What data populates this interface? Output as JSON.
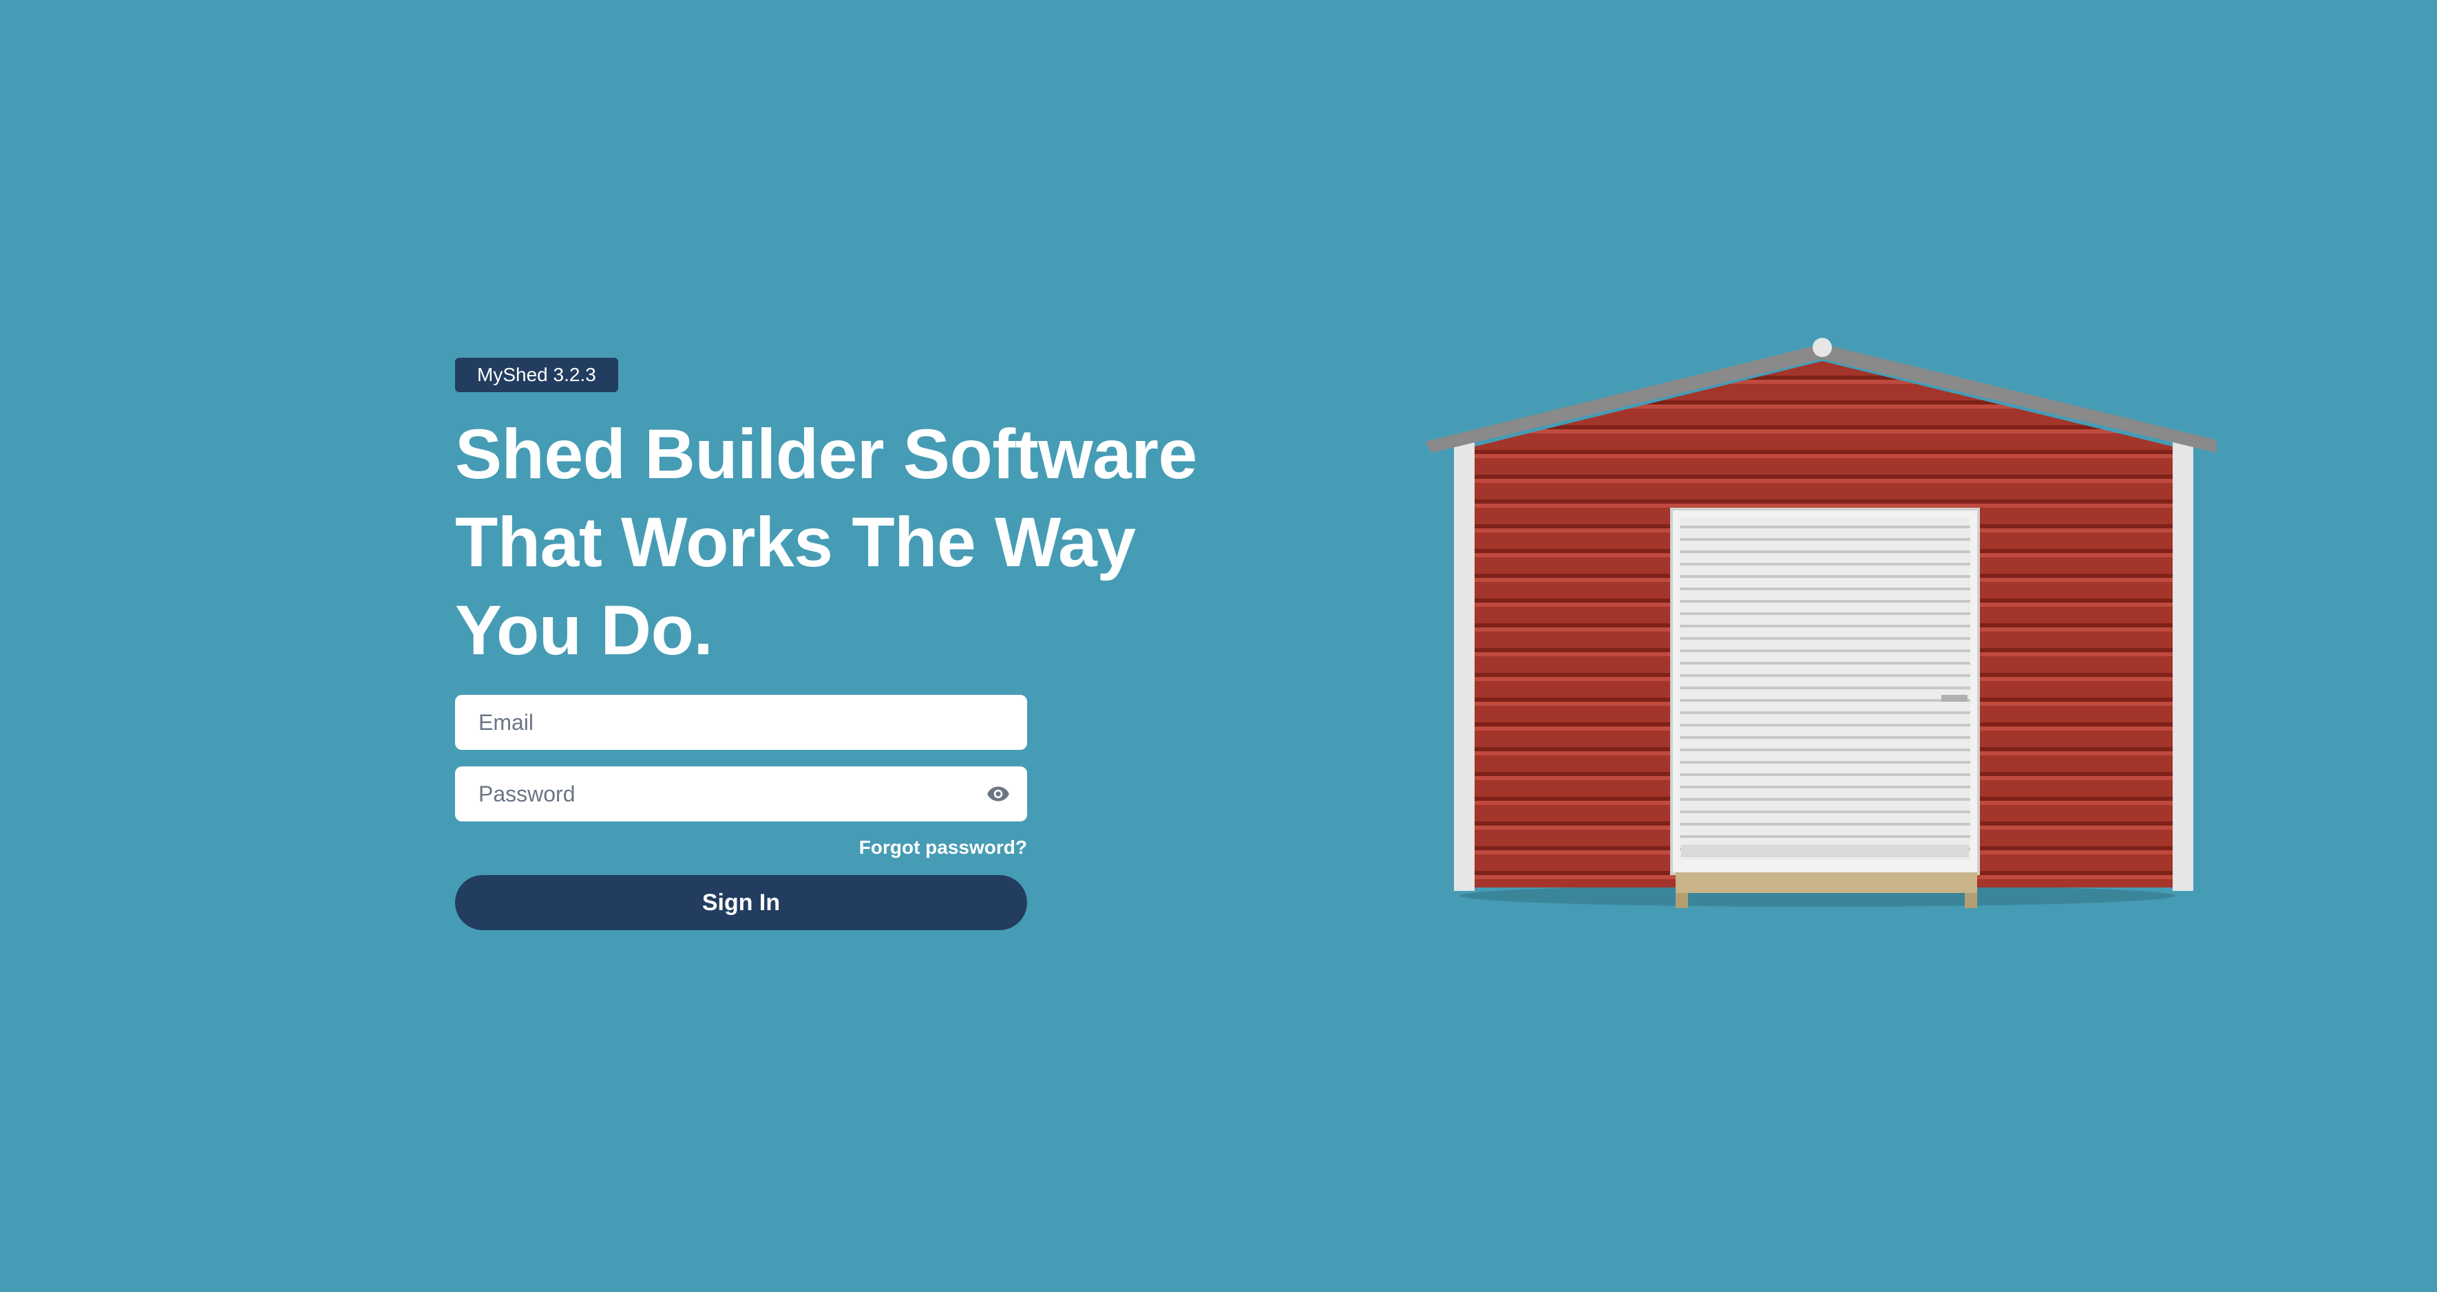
{
  "app": {
    "version_badge": "MyShed 3.2.3"
  },
  "hero": {
    "headline_line1": "Shed Builder Software",
    "headline_line2": "That Works The Way",
    "headline_line3": "You Do."
  },
  "form": {
    "email_placeholder": "Email",
    "email_value": "",
    "password_placeholder": "Password",
    "password_value": "",
    "password_toggle_icon": "eye-icon",
    "forgot_label": "Forgot password?",
    "signin_label": "Sign In"
  },
  "colors": {
    "background": "#469cb5",
    "primary": "#223d5f",
    "shed_walls": "#a3352b",
    "door": "#e8e8e8"
  }
}
